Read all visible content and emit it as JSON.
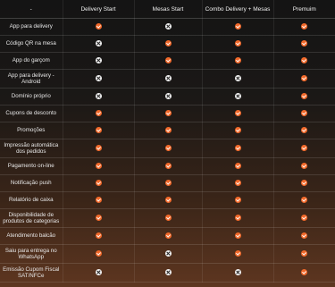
{
  "header": {
    "feature_label": "-",
    "plans": [
      "Delivery Start",
      "Mesas Start",
      "Combo Delivery + Mesas",
      "Premuim"
    ]
  },
  "icons": {
    "yes": "check-circle-icon",
    "no": "x-circle-icon"
  },
  "colors": {
    "check": "#f2692a",
    "cross": "#f4f4f4",
    "background_top": "#141414",
    "background_bottom": "#5e3620"
  },
  "rows": [
    {
      "feature": "App para delivery",
      "values": [
        "yes",
        "no",
        "yes",
        "yes"
      ]
    },
    {
      "feature": "Código QR na mesa",
      "values": [
        "no",
        "yes",
        "yes",
        "yes"
      ]
    },
    {
      "feature": "App do garçom",
      "values": [
        "no",
        "yes",
        "yes",
        "yes"
      ]
    },
    {
      "feature": "App para delivery - Android",
      "values": [
        "no",
        "no",
        "no",
        "yes"
      ]
    },
    {
      "feature": "Domínio próprio",
      "values": [
        "no",
        "no",
        "no",
        "yes"
      ]
    },
    {
      "feature": "Cupons de desconto",
      "values": [
        "yes",
        "yes",
        "yes",
        "yes"
      ]
    },
    {
      "feature": "Promoções",
      "values": [
        "yes",
        "yes",
        "yes",
        "yes"
      ]
    },
    {
      "feature": "Impressão automática dos pedidos",
      "values": [
        "yes",
        "yes",
        "yes",
        "yes"
      ]
    },
    {
      "feature": "Pagamento on-line",
      "values": [
        "yes",
        "yes",
        "yes",
        "yes"
      ]
    },
    {
      "feature": "Notificação push",
      "values": [
        "yes",
        "yes",
        "yes",
        "yes"
      ]
    },
    {
      "feature": "Relatório de caixa",
      "values": [
        "yes",
        "yes",
        "yes",
        "yes"
      ]
    },
    {
      "feature": "Disponibilidade de produtos de categorias",
      "values": [
        "yes",
        "yes",
        "yes",
        "yes"
      ]
    },
    {
      "feature": "Atendimento balcão",
      "values": [
        "yes",
        "yes",
        "yes",
        "yes"
      ]
    },
    {
      "feature": "Saiu para entrega no WhatsApp",
      "values": [
        "yes",
        "no",
        "yes",
        "yes"
      ]
    },
    {
      "feature": "Emissão Cupom Fiscal SAT/NFCe",
      "values": [
        "no",
        "no",
        "no",
        "yes"
      ]
    }
  ]
}
